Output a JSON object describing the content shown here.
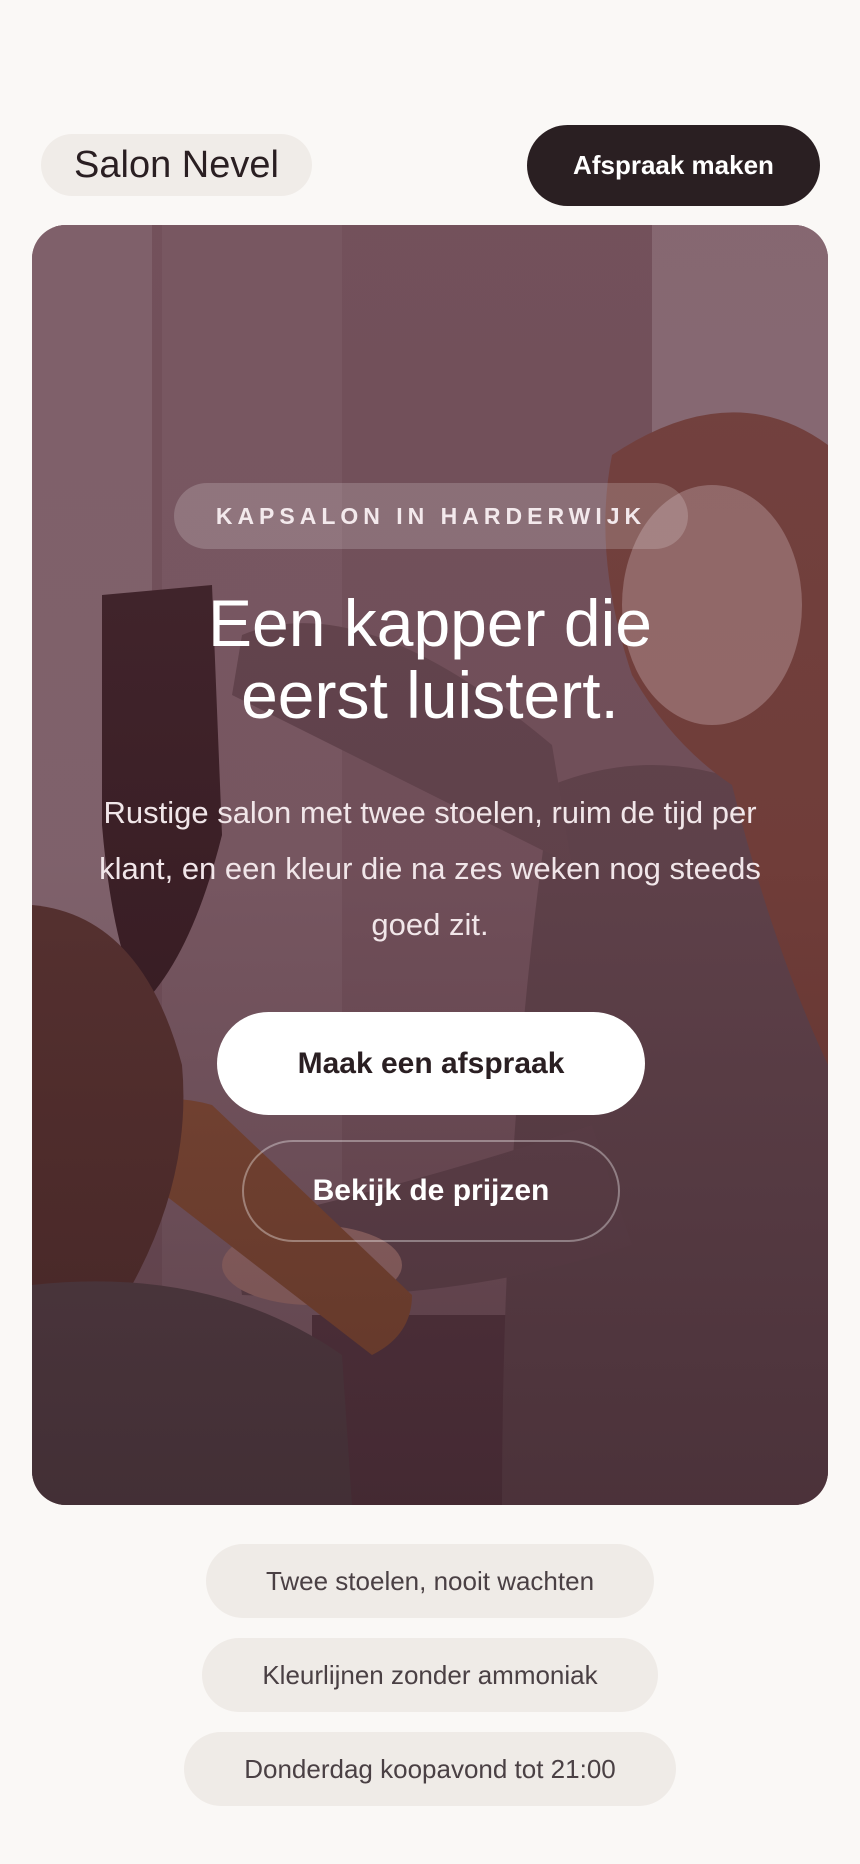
{
  "header": {
    "brand": "Salon Nevel",
    "cta_label": "Afspraak maken"
  },
  "hero": {
    "eyebrow": "KAPSALON IN HARDERWIJK",
    "title_line1": "Een kapper die",
    "title_line2": "eerst luistert.",
    "subtitle": "Rustige salon met twee stoelen, ruim de tijd per klant, en een kleur die na zes weken nog steeds goed zit.",
    "primary_button": "Maak een afspraak",
    "secondary_button": "Bekijk de prijzen"
  },
  "features": [
    {
      "label": "Twee stoelen, nooit wachten"
    },
    {
      "label": "Kleurlijnen zonder ammoniak"
    },
    {
      "label": "Donderdag koopavond tot 21:00"
    }
  ],
  "colors": {
    "accent_dark": "#2a1f22",
    "background": "#faf8f6",
    "chip_bg": "#efebe7"
  }
}
